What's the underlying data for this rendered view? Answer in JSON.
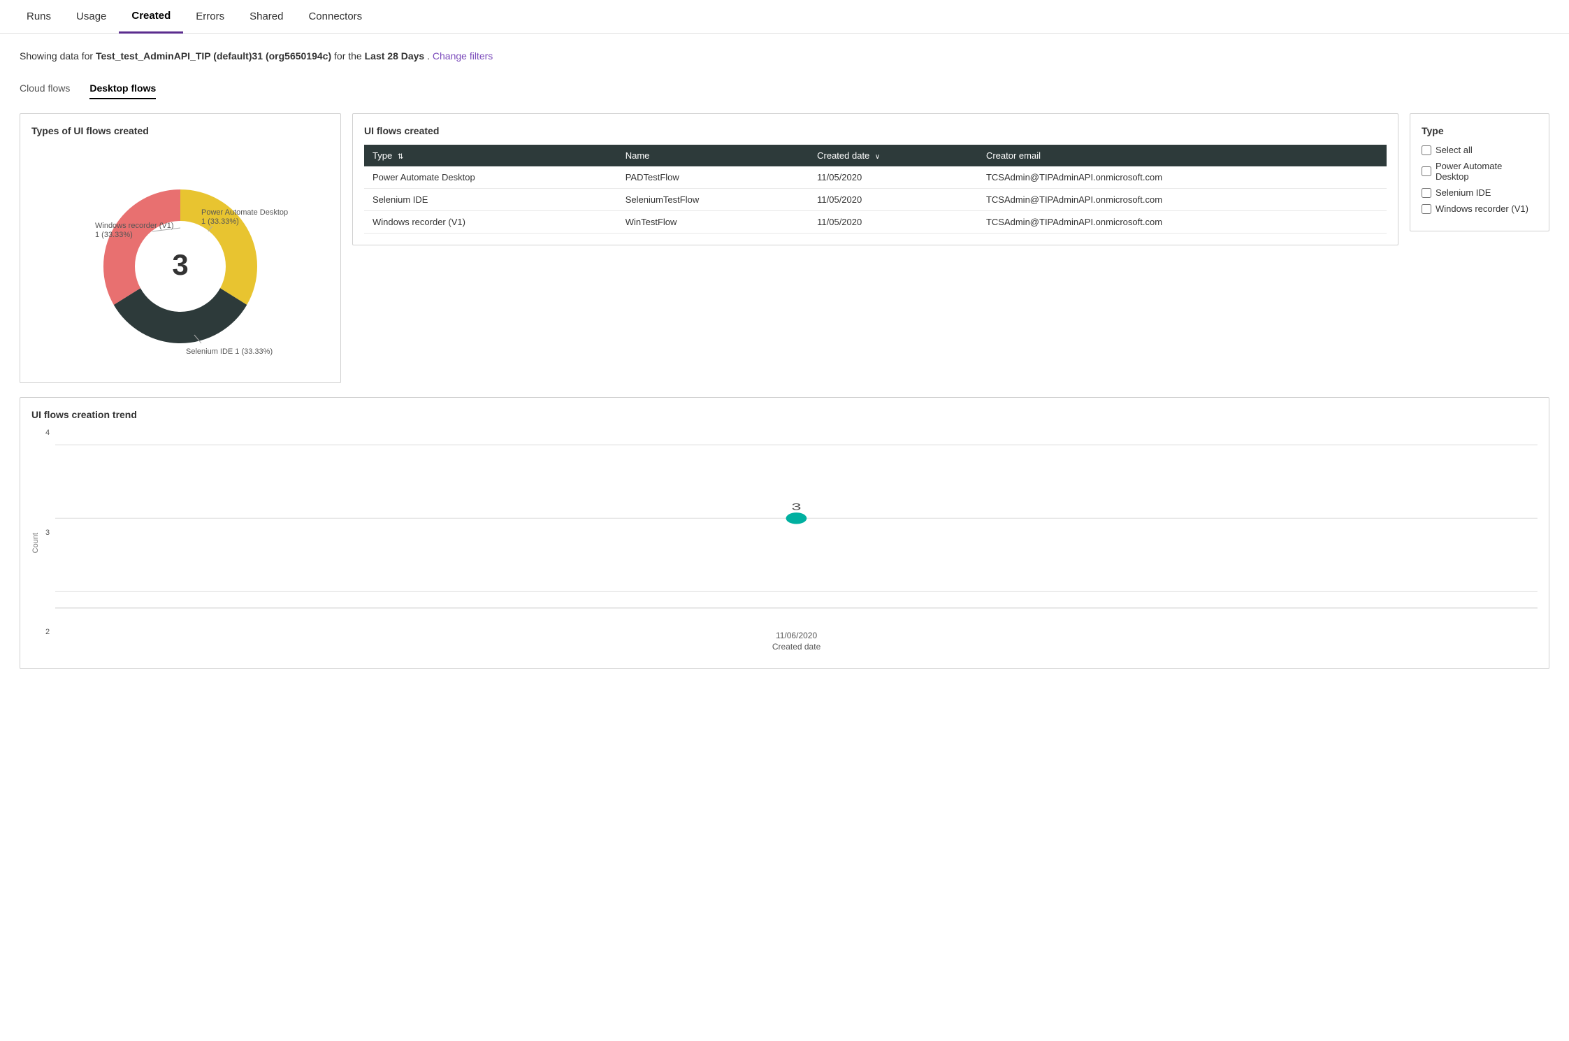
{
  "nav": {
    "items": [
      {
        "id": "runs",
        "label": "Runs",
        "active": false
      },
      {
        "id": "usage",
        "label": "Usage",
        "active": false
      },
      {
        "id": "created",
        "label": "Created",
        "active": true
      },
      {
        "id": "errors",
        "label": "Errors",
        "active": false
      },
      {
        "id": "shared",
        "label": "Shared",
        "active": false
      },
      {
        "id": "connectors",
        "label": "Connectors",
        "active": false
      }
    ]
  },
  "filter_text": {
    "prefix": "Showing data for ",
    "env": "Test_test_AdminAPI_TIP (default)31 (org5650194c)",
    "middle": " for the ",
    "period": "Last 28 Days",
    "suffix": ".",
    "change_filters_label": "Change filters"
  },
  "sub_tabs": [
    {
      "id": "cloud-flows",
      "label": "Cloud flows",
      "active": false
    },
    {
      "id": "desktop-flows",
      "label": "Desktop flows",
      "active": true
    }
  ],
  "donut_chart": {
    "title": "Types of UI flows created",
    "center_value": "3",
    "segments": [
      {
        "label": "Windows recorder (V1)",
        "value": "1 (33.33%)",
        "color": "#e8c430",
        "percent": 33.33
      },
      {
        "label": "Power Automate Desktop",
        "value": "1 (33.33%)",
        "color": "#2d3a3a",
        "percent": 33.33
      },
      {
        "label": "Selenium IDE",
        "value": "1 (33.33%)",
        "color": "#e87070",
        "percent": 33.34
      }
    ]
  },
  "table": {
    "title": "UI flows created",
    "columns": [
      {
        "id": "type",
        "label": "Type",
        "sortable": true
      },
      {
        "id": "name",
        "label": "Name",
        "sortable": false
      },
      {
        "id": "created_date",
        "label": "Created date",
        "sortable": true,
        "sorted": "desc"
      },
      {
        "id": "creator_email",
        "label": "Creator email",
        "sortable": false
      }
    ],
    "rows": [
      {
        "type": "Power Automate Desktop",
        "name": "PADTestFlow",
        "created_date": "11/05/2020",
        "creator_email": "TCSAdmin@TIPAdminAPI.onmicrosoft.com"
      },
      {
        "type": "Selenium IDE",
        "name": "SeleniumTestFlow",
        "created_date": "11/05/2020",
        "creator_email": "TCSAdmin@TIPAdminAPI.onmicrosoft.com"
      },
      {
        "type": "Windows recorder (V1)",
        "name": "WinTestFlow",
        "created_date": "11/05/2020",
        "creator_email": "TCSAdmin@TIPAdminAPI.onmicrosoft.com"
      }
    ]
  },
  "type_filter": {
    "title": "Type",
    "select_all_label": "Select all",
    "items": [
      {
        "id": "pad",
        "label": "Power Automate Desktop",
        "checked": false
      },
      {
        "id": "selenium",
        "label": "Selenium IDE",
        "checked": false
      },
      {
        "id": "windows-recorder",
        "label": "Windows recorder (V1)",
        "checked": false
      }
    ]
  },
  "trend_chart": {
    "title": "UI flows creation trend",
    "y_axis_label": "Count",
    "x_axis_label": "Created date",
    "y_labels": [
      "4",
      "3",
      "2"
    ],
    "data_points": [
      {
        "x_label": "11/06/2020",
        "value": 3,
        "x_pct": 50,
        "y_pct": 50
      }
    ],
    "grid_lines": [
      4,
      3,
      2
    ]
  }
}
